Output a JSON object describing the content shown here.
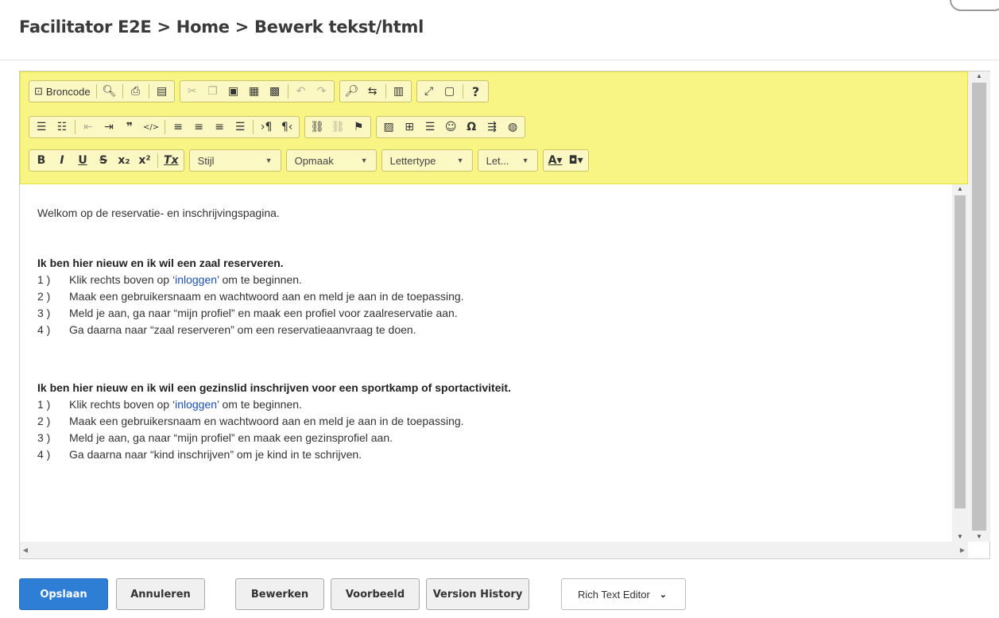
{
  "header": {
    "title": "Facilitator E2E > Home > Bewerk tekst/html"
  },
  "toolbar": {
    "source_label": "Broncode",
    "style_combo": "Stijl",
    "format_combo": "Opmaak",
    "font_combo": "Lettertype",
    "size_combo": "Let...",
    "help_label": "?",
    "icons": [
      "document-icon",
      "preview-icon",
      "print-icon",
      "templates-icon",
      "cut-icon",
      "copy-icon",
      "paste-icon",
      "paste-text-icon",
      "paste-word-icon",
      "undo-icon",
      "redo-icon",
      "find-icon",
      "replace-icon",
      "select-all-icon",
      "maximize-icon",
      "show-blocks-icon",
      "help-icon",
      "numbered-list-icon",
      "bullet-list-icon",
      "outdent-icon",
      "indent-icon",
      "blockquote-icon",
      "div-icon",
      "align-left-icon",
      "align-center-icon",
      "align-right-icon",
      "justify-icon",
      "ltr-icon",
      "rtl-icon",
      "link-icon",
      "unlink-icon",
      "anchor-icon",
      "image-icon",
      "table-icon",
      "hr-icon",
      "smiley-icon",
      "special-char-icon",
      "page-break-icon",
      "iframe-icon",
      "bold-icon",
      "italic-icon",
      "underline-icon",
      "strike-icon",
      "subscript-icon",
      "superscript-icon",
      "remove-format-icon",
      "text-color-icon",
      "bg-color-icon"
    ]
  },
  "content": {
    "welcome": "Welkom op de reservatie- en inschrijvingspagina.",
    "section1": {
      "heading": "Ik ben hier nieuw en ik wil een zaal reserveren.",
      "items": [
        {
          "num": "1 )",
          "pre": "Klik rechts boven op ‘",
          "link": "inloggen",
          "post": "’ om te beginnen."
        },
        {
          "num": "2 )",
          "pre": "Maak een gebruikersnaam en wachtwoord aan en meld je aan in de toepassing."
        },
        {
          "num": "3 )",
          "pre": "Meld je aan, ga naar “mijn profiel” en maak een profiel voor zaalreservatie aan."
        },
        {
          "num": "4 )",
          "pre": "Ga daarna naar “zaal reserveren” om een reservatieaanvraag te doen."
        }
      ]
    },
    "section2": {
      "heading": "Ik ben hier nieuw en ik wil een gezinslid inschrijven voor een sportkamp of sportactiviteit.",
      "items": [
        {
          "num": "1 )",
          "pre": "Klik rechts boven op ‘",
          "link": "inloggen",
          "post": "’ om te beginnen."
        },
        {
          "num": "2 )",
          "pre": "Maak een gebruikersnaam en wachtwoord aan en meld je aan in de toepassing."
        },
        {
          "num": "3 )",
          "pre": "Meld je aan, ga naar “mijn profiel” en maak een gezinsprofiel aan."
        },
        {
          "num": "4 )",
          "pre": "Ga daarna naar “kind inschrijven” om je kind in te schrijven."
        }
      ]
    }
  },
  "actions": {
    "save": "Opslaan",
    "cancel": "Annuleren",
    "edit": "Bewerken",
    "preview": "Voorbeeld",
    "history": "Version History",
    "editor_mode": "Rich Text Editor"
  },
  "colors": {
    "toolbar_highlight": "#f9f584",
    "primary": "#2e7ed6",
    "link": "#1a4fb5"
  }
}
